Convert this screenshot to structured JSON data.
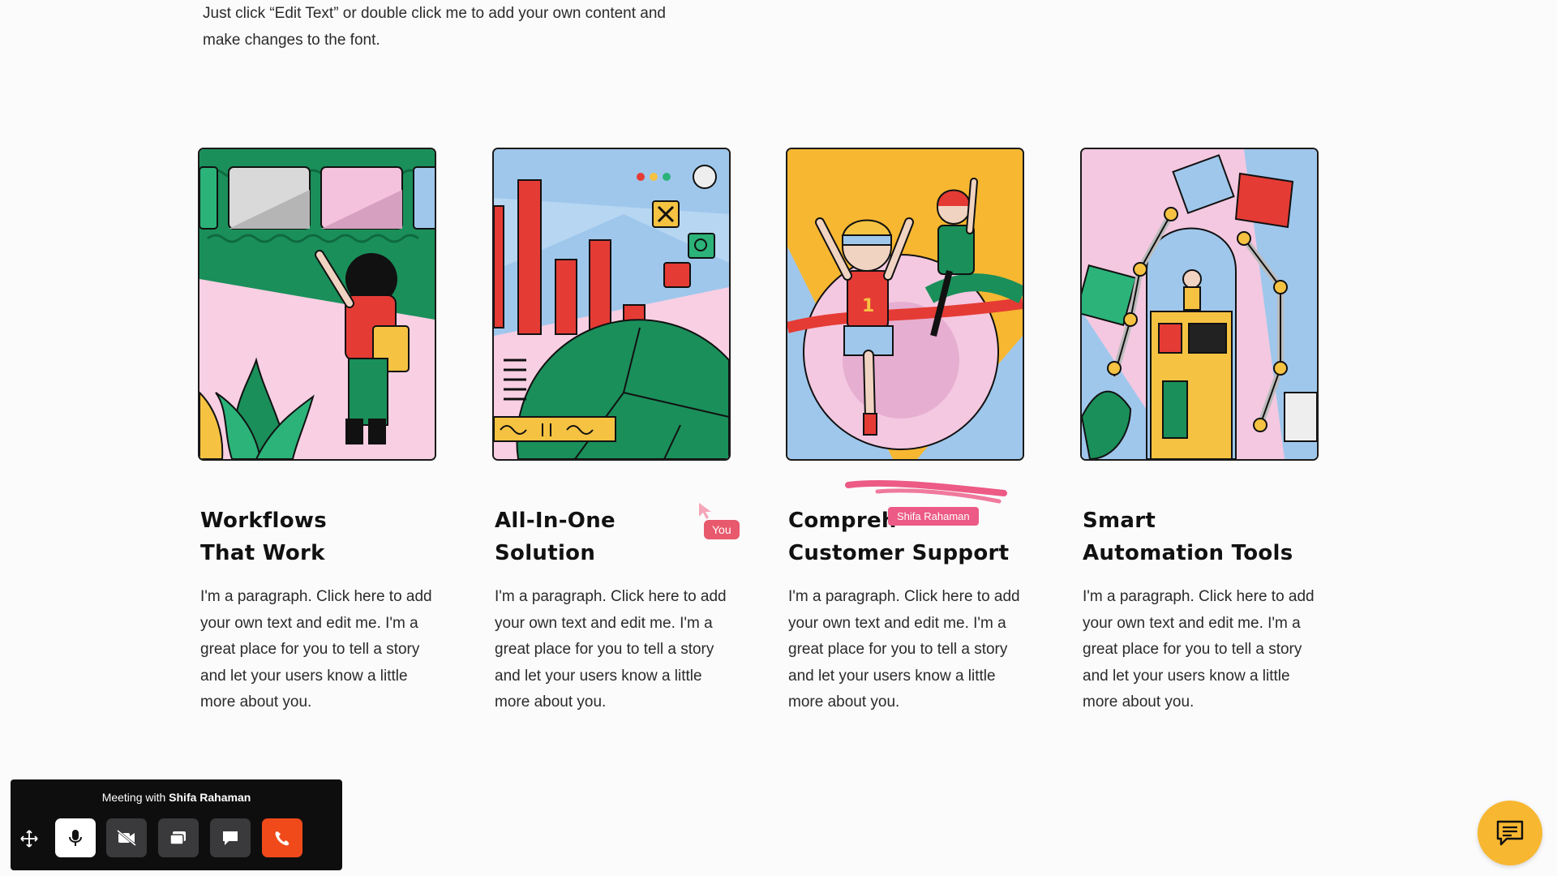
{
  "intro": {
    "line1": "Just click “Edit Text” or double click me to add your own content and",
    "line2": "make changes to the font."
  },
  "cards": [
    {
      "title_line1": "Workflows",
      "title_line2": "That Work",
      "paragraph": "I'm a paragraph. Click here to add your own text and edit me. I'm a great place for you to tell a story and let your users know a little more about you."
    },
    {
      "title_line1": "All-In-One",
      "title_line2": "Solution",
      "paragraph": "I'm a paragraph. Click here to add your own text and edit me. I'm a great place for you to tell a story and let your users know a little more about you."
    },
    {
      "title_line1": "Compreh",
      "title_line2": "Customer Support",
      "paragraph": "I'm a paragraph. Click here to add your own text and edit me. I'm a great place for you to tell a story and let your users know a little more about you."
    },
    {
      "title_line1": "Smart",
      "title_line2": "Automation Tools",
      "paragraph": "I'm a paragraph. Click here to add your own text and edit me. I'm a great place for you to tell a story and let your users know a little more about you."
    }
  ],
  "cursors": {
    "you_label": "You",
    "other_label": "Shifa Rahaman"
  },
  "meeting": {
    "prefix": "Meeting with ",
    "name": "Shifa Rahaman",
    "buttons": [
      "move-icon",
      "microphone-icon",
      "camera-off-icon",
      "screen-share-icon",
      "chat-bubble-icon",
      "end-call-icon"
    ]
  },
  "colors": {
    "accent_green": "#1a8f5a",
    "accent_yellow": "#f7b731",
    "accent_red": "#e03a3a",
    "pink": "#f8cfe3",
    "sky": "#9fc7ec",
    "end_call": "#f04a1b"
  }
}
